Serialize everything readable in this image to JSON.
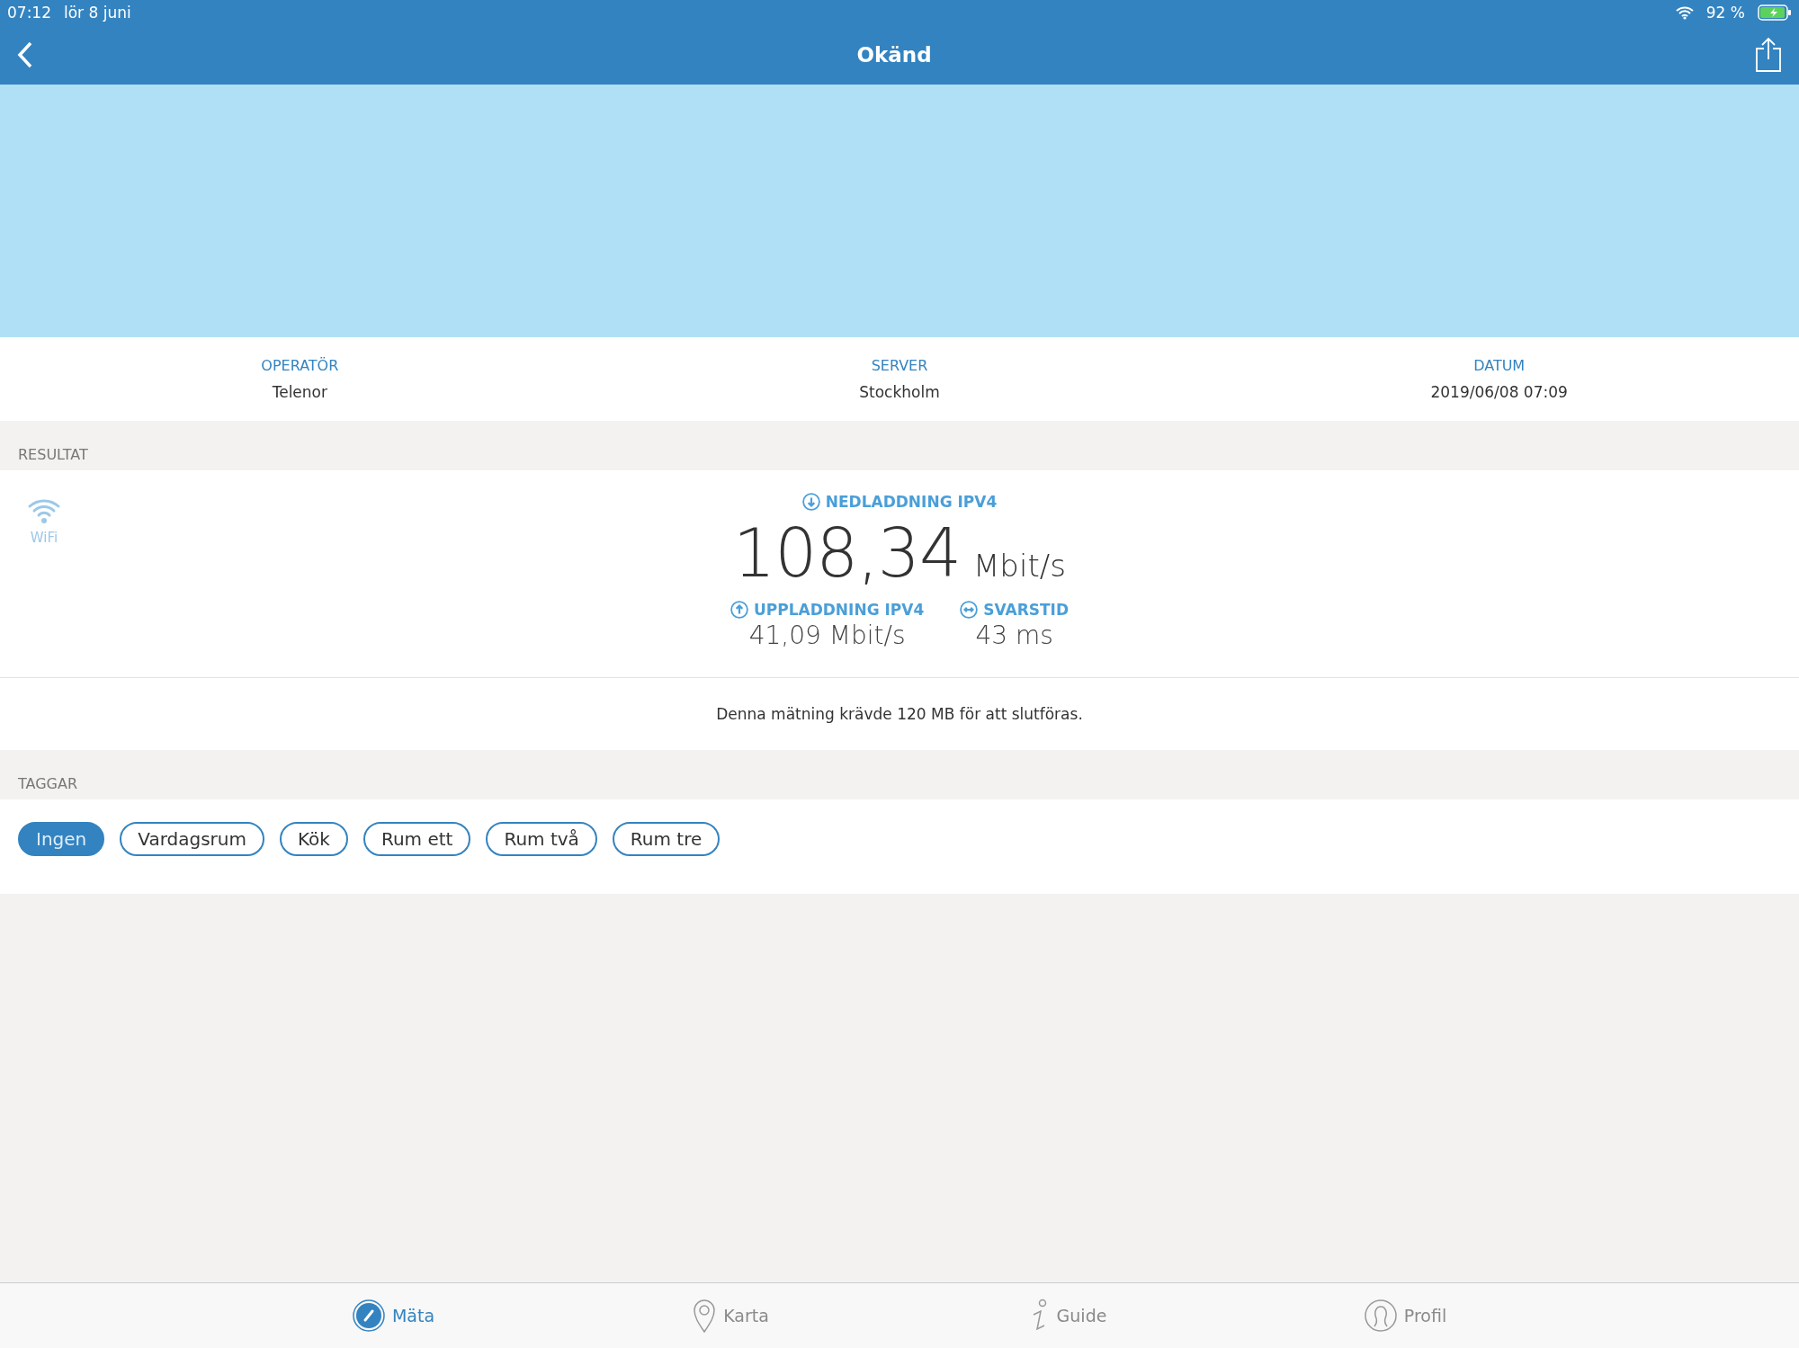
{
  "status_bar": {
    "time": "07:12",
    "date": "lör 8 juni",
    "battery": "92 %"
  },
  "nav_bar": {
    "title": "Okänd"
  },
  "info": [
    {
      "label": "OPERATÖR",
      "value": "Telenor"
    },
    {
      "label": "SERVER",
      "value": "Stockholm"
    },
    {
      "label": "DATUM",
      "value": "2019/06/08 07:09"
    }
  ],
  "results": {
    "header": "RESULTAT",
    "connection": "WiFi",
    "download": {
      "label": "NEDLADDNING IPV4",
      "value": "108,34",
      "unit": "Mbit/s"
    },
    "upload": {
      "label": "UPPLADDNING IPV4",
      "value": "41,09 Mbit/s"
    },
    "latency": {
      "label": "SVARSTID",
      "value": "43 ms"
    },
    "note": "Denna mätning krävde 120 MB för att slutföras."
  },
  "tags": {
    "header": "TAGGAR",
    "items": [
      {
        "label": "Ingen",
        "selected": true
      },
      {
        "label": "Vardagsrum",
        "selected": false
      },
      {
        "label": "Kök",
        "selected": false
      },
      {
        "label": "Rum ett",
        "selected": false
      },
      {
        "label": "Rum två",
        "selected": false
      },
      {
        "label": "Rum tre",
        "selected": false
      }
    ]
  },
  "tab_bar": [
    {
      "kind": "gauge",
      "label": "Mäta",
      "selected": true
    },
    {
      "kind": "pin",
      "label": "Karta",
      "selected": false
    },
    {
      "kind": "info",
      "label": "Guide",
      "selected": false
    },
    {
      "kind": "person",
      "label": "Profil",
      "selected": false
    }
  ]
}
